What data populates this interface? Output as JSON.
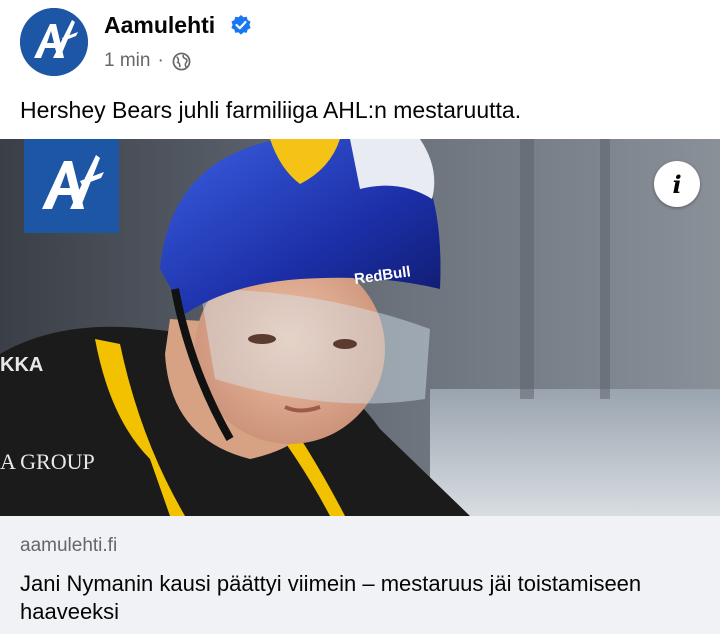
{
  "post": {
    "page_name": "Aamulehti",
    "timestamp": "1 min",
    "separator": "·",
    "privacy_icon": "globe-icon",
    "verified_icon": "verified-badge-icon",
    "text": "Hershey Bears juhli farmiliiga AHL:n mestaruutta."
  },
  "media": {
    "info_label": "i",
    "logo": "aamulehti-logo",
    "photo_description_icon": "hockey-player-photo"
  },
  "link": {
    "domain": "aamulehti.fi",
    "title": "Jani Nymanin kausi päättyi viimein – mestaruus jäi toistamiseen haaveeksi"
  },
  "colors": {
    "brand_blue": "#1e56a6",
    "verified_blue": "#1877f2",
    "secondary_text": "#65676b",
    "card_bg": "#f0f2f5"
  }
}
